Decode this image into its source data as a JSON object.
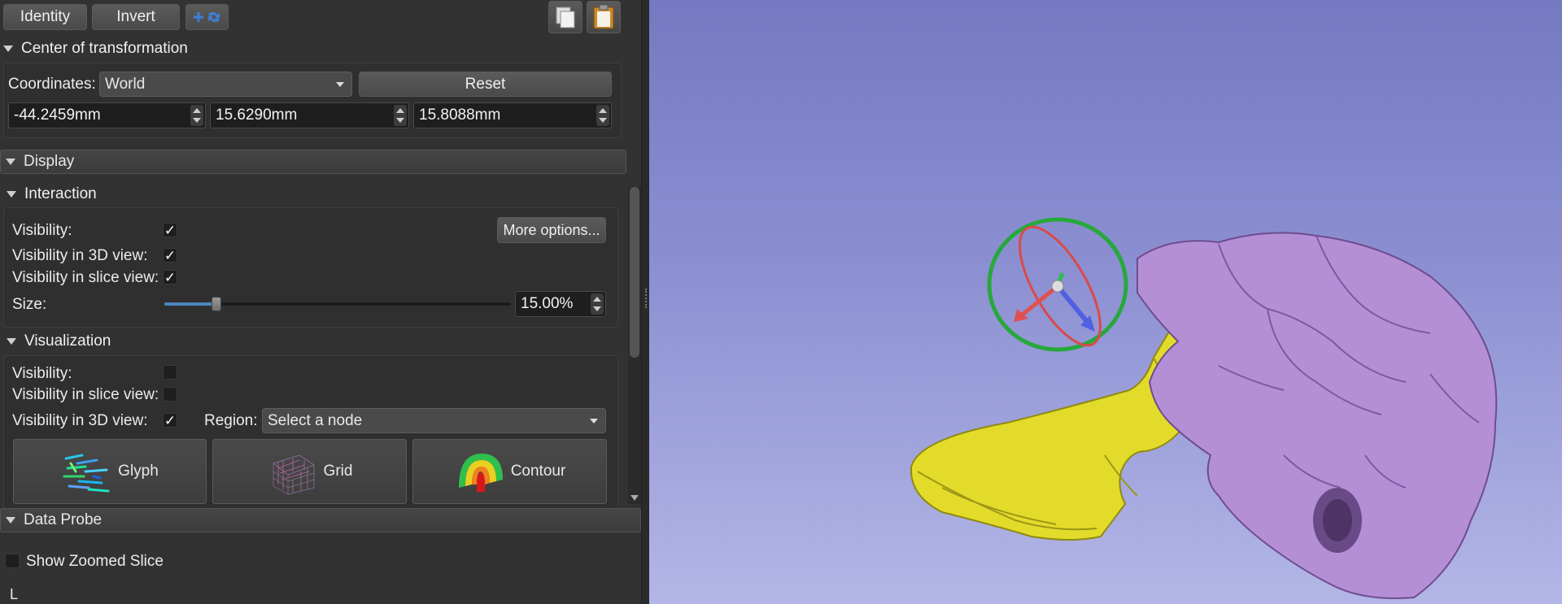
{
  "toolbar": {
    "identity_label": "Identity",
    "invert_label": "Invert",
    "split_icon": "split-transform-icon",
    "copy_icon": "copy-icon",
    "paste_icon": "paste-icon"
  },
  "center": {
    "title": "Center of transformation",
    "coordinates_label": "Coordinates:",
    "coordinates_value": "World",
    "reset_label": "Reset",
    "x": "-44.2459mm",
    "y": "15.6290mm",
    "z": "15.8088mm"
  },
  "display": {
    "title": "Display",
    "interaction": {
      "title": "Interaction",
      "visibility_label": "Visibility:",
      "visibility_checked": true,
      "visibility_3d_label": "Visibility in 3D view:",
      "visibility_3d_checked": true,
      "visibility_slice_label": "Visibility in slice view:",
      "visibility_slice_checked": true,
      "more_options_label": "More options...",
      "size_label": "Size:",
      "size_value": "15.00%",
      "size_fraction": 0.15
    },
    "visualization": {
      "title": "Visualization",
      "visibility_label": "Visibility:",
      "visibility_checked": false,
      "visibility_slice_label": "Visibility in slice view:",
      "visibility_slice_checked": false,
      "visibility_3d_label": "Visibility in 3D view:",
      "visibility_3d_checked": true,
      "region_label": "Region:",
      "region_value": "Select a node",
      "modes": [
        {
          "label": "Glyph",
          "icon": "glyph-icon"
        },
        {
          "label": "Grid",
          "icon": "grid-icon"
        },
        {
          "label": "Contour",
          "icon": "contour-icon"
        }
      ]
    }
  },
  "data_probe": {
    "title": "Data Probe",
    "show_zoomed_label": "Show Zoomed Slice",
    "show_zoomed_checked": false,
    "corner_text": "L"
  },
  "colors": {
    "panel_bg": "#323232",
    "view_bg_top": "#7479c1",
    "view_bg_bottom": "#b3b6e6",
    "skull": "#b48fd6",
    "jaw": "#e3dc2a",
    "accent": "#4d86c0"
  }
}
